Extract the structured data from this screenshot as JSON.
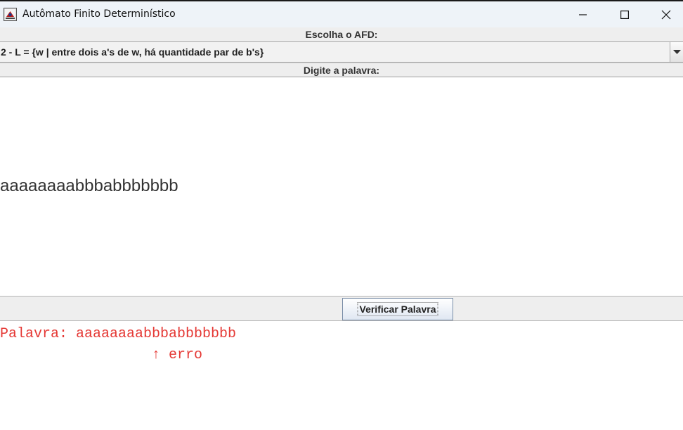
{
  "window": {
    "title": "Autômato Finito Determinístico"
  },
  "afd": {
    "label": "Escolha o AFD:",
    "selected": "2 - L = {w | entre dois a's de w, há quantidade par de b's}"
  },
  "word": {
    "label": "Digite a palavra:",
    "value": "aaaaaaaabbbabbbbbbb"
  },
  "actions": {
    "verify_label": "Verificar Palavra"
  },
  "output": {
    "line1": "Palavra: aaaaaaaabbbabbbbbbb",
    "line2": "                  ↑ erro"
  },
  "colors": {
    "error_text": "#e53935",
    "panel_bg": "#eeeeee",
    "titlebar_bg": "#eef3f8"
  },
  "icons": [
    "app-icon",
    "minimize-icon",
    "maximize-icon",
    "close-icon",
    "chevron-down-icon"
  ]
}
